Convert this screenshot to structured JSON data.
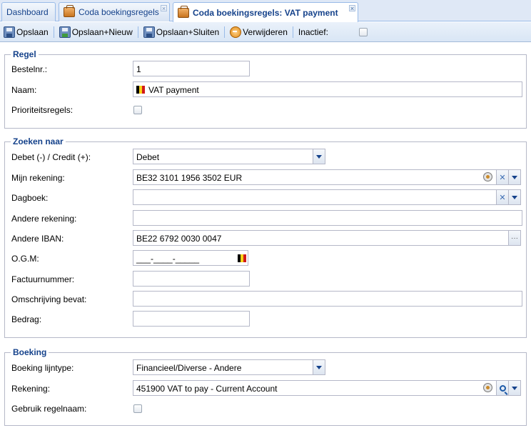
{
  "tabs": [
    {
      "label": "Dashboard"
    },
    {
      "label": "Coda boekingsregels"
    },
    {
      "label": "Coda boekingsregels: VAT payment"
    }
  ],
  "toolbar": {
    "save_label": "Opslaan",
    "save_new_label": "Opslaan+Nieuw",
    "save_close_label": "Opslaan+Sluiten",
    "delete_label": "Verwijderen",
    "inactive_label": "Inactief:",
    "inactive_checked": false
  },
  "regel": {
    "legend": "Regel",
    "bestelnr_label": "Bestelnr.:",
    "bestelnr_value": "1",
    "naam_label": "Naam:",
    "naam_value": "VAT payment",
    "prioriteit_label": "Prioriteitsregels:",
    "prioriteit_checked": false
  },
  "zoeken": {
    "legend": "Zoeken naar",
    "debet_label": "Debet (-) / Credit (+):",
    "debet_value": "Debet",
    "mijn_rekening_label": "Mijn rekening:",
    "mijn_rekening_value": "BE32 3101 1956 3502  EUR",
    "dagboek_label": "Dagboek:",
    "dagboek_value": "",
    "andere_rekening_label": "Andere rekening:",
    "andere_rekening_value": "",
    "andere_iban_label": "Andere IBAN:",
    "andere_iban_value": "BE22 6792 0030 0047",
    "ogm_label": "O.G.M:",
    "ogm_value": "___-____-_____",
    "factuur_label": "Factuurnummer:",
    "factuur_value": "",
    "omschrijving_label": "Omschrijving bevat:",
    "omschrijving_value": "",
    "bedrag_label": "Bedrag:",
    "bedrag_value": ""
  },
  "boeking": {
    "legend": "Boeking",
    "lijntype_label": "Boeking lijntype:",
    "lijntype_value": "Financieel/Diverse - Andere",
    "rekening_label": "Rekening:",
    "rekening_value": "451900 VAT to pay - Current Account",
    "regelnaam_label": "Gebruik regelnaam:",
    "regelnaam_checked": false
  },
  "colors": {
    "legend": "#15428b",
    "tab_border": "#99bbe8",
    "field_border": "#b5b8c8"
  }
}
